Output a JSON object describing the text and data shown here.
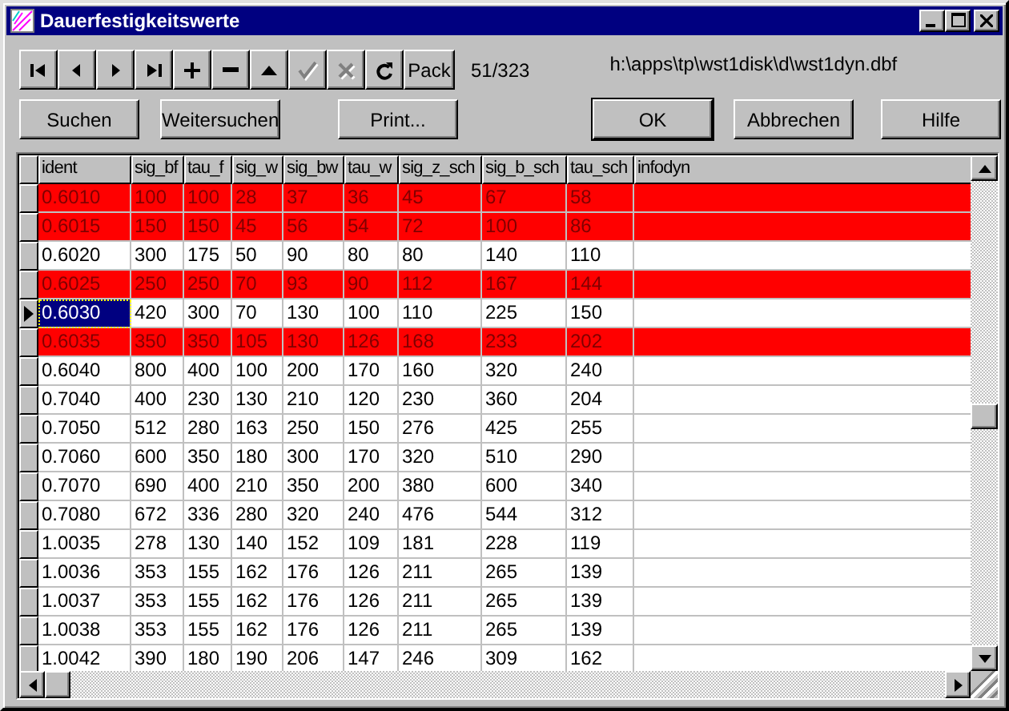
{
  "window": {
    "title": "Dauerfestigkeitswerte"
  },
  "navigator": [
    {
      "kind": "first",
      "disabled": false
    },
    {
      "kind": "prior",
      "disabled": false
    },
    {
      "kind": "next",
      "disabled": false
    },
    {
      "kind": "last",
      "disabled": false
    },
    {
      "kind": "insert",
      "disabled": false
    },
    {
      "kind": "delete",
      "disabled": false
    },
    {
      "kind": "edit",
      "disabled": false
    },
    {
      "kind": "post",
      "disabled": true
    },
    {
      "kind": "cancel",
      "disabled": true
    },
    {
      "kind": "refresh",
      "disabled": false
    },
    {
      "kind": "text",
      "label": "Pack",
      "disabled": false
    }
  ],
  "record_count": "51/323",
  "file_path": "h:\\apps\\tp\\wst1disk\\d\\wst1dyn.dbf",
  "buttons": [
    {
      "label": "Suchen",
      "default": false
    },
    {
      "label": "Weitersuchen",
      "default": false
    },
    {
      "label": "Print...",
      "default": false
    },
    {
      "label": "OK",
      "default": true
    },
    {
      "label": "Abbrechen",
      "default": false
    },
    {
      "label": "Hilfe",
      "default": false
    }
  ],
  "table": {
    "columns": [
      "ident",
      "sig_bf",
      "tau_f",
      "sig_w",
      "sig_bw",
      "tau_w",
      "sig_z_sch",
      "sig_b_sch",
      "tau_sch",
      "infodyn"
    ],
    "rows": [
      {
        "cells": [
          "0.6010",
          "100",
          "100",
          "28",
          "37",
          "36",
          "45",
          "67",
          "58",
          ""
        ],
        "highlighted": true,
        "selected": false
      },
      {
        "cells": [
          "0.6015",
          "150",
          "150",
          "45",
          "56",
          "54",
          "72",
          "100",
          "86",
          ""
        ],
        "highlighted": true,
        "selected": false
      },
      {
        "cells": [
          "0.6020",
          "300",
          "175",
          "50",
          "90",
          "80",
          "80",
          "140",
          "110",
          ""
        ],
        "highlighted": false,
        "selected": false
      },
      {
        "cells": [
          "0.6025",
          "250",
          "250",
          "70",
          "93",
          "90",
          "112",
          "167",
          "144",
          ""
        ],
        "highlighted": true,
        "selected": false
      },
      {
        "cells": [
          "0.6030",
          "420",
          "300",
          "70",
          "130",
          "100",
          "110",
          "225",
          "150",
          ""
        ],
        "highlighted": false,
        "selected": true
      },
      {
        "cells": [
          "0.6035",
          "350",
          "350",
          "105",
          "130",
          "126",
          "168",
          "233",
          "202",
          ""
        ],
        "highlighted": true,
        "selected": false
      },
      {
        "cells": [
          "0.6040",
          "800",
          "400",
          "100",
          "200",
          "170",
          "160",
          "320",
          "240",
          ""
        ],
        "highlighted": false,
        "selected": false
      },
      {
        "cells": [
          "0.7040",
          "400",
          "230",
          "130",
          "210",
          "120",
          "230",
          "360",
          "204",
          ""
        ],
        "highlighted": false,
        "selected": false
      },
      {
        "cells": [
          "0.7050",
          "512",
          "280",
          "163",
          "250",
          "150",
          "276",
          "425",
          "255",
          ""
        ],
        "highlighted": false,
        "selected": false
      },
      {
        "cells": [
          "0.7060",
          "600",
          "350",
          "180",
          "300",
          "170",
          "320",
          "510",
          "290",
          ""
        ],
        "highlighted": false,
        "selected": false
      },
      {
        "cells": [
          "0.7070",
          "690",
          "400",
          "210",
          "350",
          "200",
          "380",
          "600",
          "340",
          ""
        ],
        "highlighted": false,
        "selected": false
      },
      {
        "cells": [
          "0.7080",
          "672",
          "336",
          "280",
          "320",
          "240",
          "476",
          "544",
          "312",
          ""
        ],
        "highlighted": false,
        "selected": false
      },
      {
        "cells": [
          "1.0035",
          "278",
          "130",
          "140",
          "152",
          "109",
          "181",
          "228",
          "119",
          ""
        ],
        "highlighted": false,
        "selected": false
      },
      {
        "cells": [
          "1.0036",
          "353",
          "155",
          "162",
          "176",
          "126",
          "211",
          "265",
          "139",
          ""
        ],
        "highlighted": false,
        "selected": false
      },
      {
        "cells": [
          "1.0037",
          "353",
          "155",
          "162",
          "176",
          "126",
          "211",
          "265",
          "139",
          ""
        ],
        "highlighted": false,
        "selected": false
      },
      {
        "cells": [
          "1.0038",
          "353",
          "155",
          "162",
          "176",
          "126",
          "211",
          "265",
          "139",
          ""
        ],
        "highlighted": false,
        "selected": false
      },
      {
        "cells": [
          "1.0042",
          "390",
          "180",
          "190",
          "206",
          "147",
          "246",
          "309",
          "162",
          ""
        ],
        "highlighted": false,
        "selected": false
      }
    ]
  }
}
